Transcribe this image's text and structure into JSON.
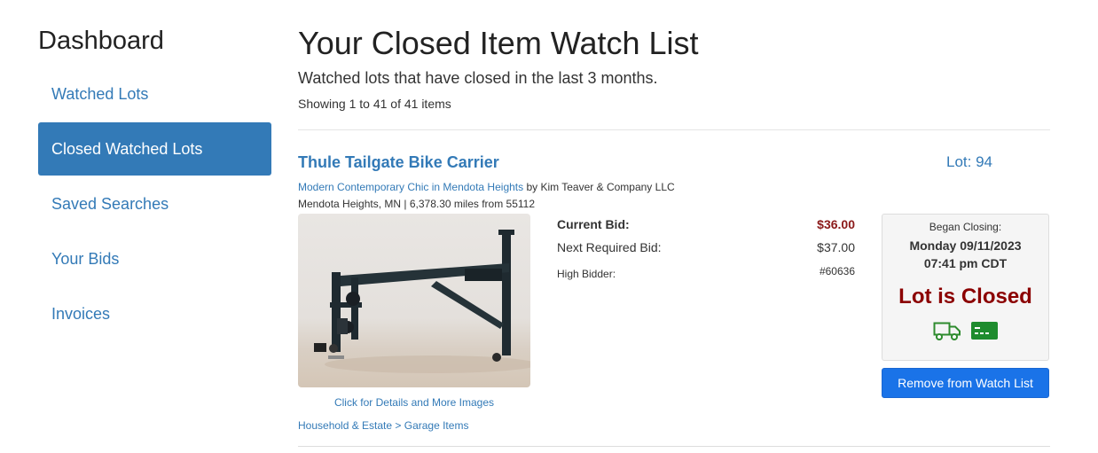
{
  "sidebar": {
    "title": "Dashboard",
    "items": [
      {
        "label": "Watched Lots"
      },
      {
        "label": "Closed Watched Lots"
      },
      {
        "label": "Saved Searches"
      },
      {
        "label": "Your Bids"
      },
      {
        "label": "Invoices"
      }
    ]
  },
  "main": {
    "title": "Your Closed Item Watch List",
    "subtitle": "Watched lots that have closed in the last 3 months.",
    "showing": "Showing 1 to 41 of 41 items"
  },
  "lot": {
    "title": "Thule Tailgate Bike Carrier",
    "lot_number": "Lot: 94",
    "auction_link": "Modern Contemporary Chic in Mendota Heights",
    "seller": "by Kim Teaver & Company LLC",
    "location": "Mendota Heights, MN | 6,378.30 miles from 55112",
    "current_bid_label": "Current Bid:",
    "current_bid_value": "$36.00",
    "next_bid_label": "Next Required Bid:",
    "next_bid_value": "$37.00",
    "high_bidder_label": "High Bidder:",
    "high_bidder_value": "#60636",
    "began_closing_label": "Began Closing:",
    "closing_date": "Monday 09/11/2023",
    "closing_time": "07:41 pm CDT",
    "status": "Lot is Closed",
    "photo_link": "Click for Details and More Images",
    "category": "Household & Estate > Garage Items",
    "remove_button": "Remove from Watch List",
    "icons": [
      "truck-icon",
      "payment-card-icon"
    ]
  },
  "colors": {
    "link": "#337ab7",
    "active_nav": "#337ab7",
    "closed_red": "#8b0000",
    "bid_red": "#8b1a1a",
    "button_blue": "#1a73e8",
    "icon_green": "#2e8b2e"
  }
}
